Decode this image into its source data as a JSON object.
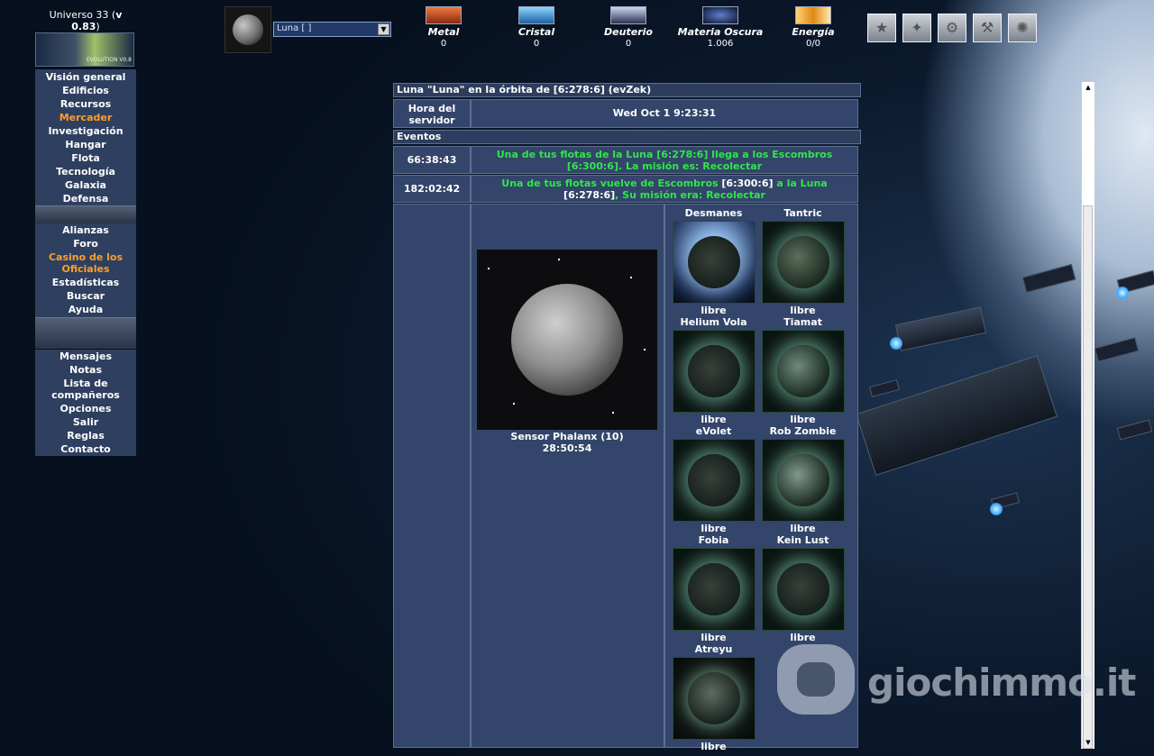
{
  "header": {
    "universe_label": "Universo 33 (",
    "version": "v 0.83",
    "universe_close": ")",
    "banner_text": "EVOLUTION V0.8",
    "planet_select_value": "Luna [ ]"
  },
  "resources": [
    {
      "name": "Metal",
      "value": "0"
    },
    {
      "name": "Cristal",
      "value": "0"
    },
    {
      "name": "Deuterio",
      "value": "0"
    },
    {
      "name": "Materia Oscura",
      "value": "1.006"
    },
    {
      "name": "Energía",
      "value": "0/0"
    }
  ],
  "menu": {
    "group1": [
      "Visión general",
      "Edificios",
      "Recursos",
      "Mercader",
      "Investigación",
      "Hangar",
      "Flota",
      "Tecnología",
      "Galaxia",
      "Defensa"
    ],
    "group2": [
      "Alianzas",
      "Foro",
      "Casino de los Oficiales",
      "Estadísticas",
      "Buscar",
      "Ayuda"
    ],
    "group3": [
      "Mensajes",
      "Notas",
      "Lista de compañeros",
      "Opciones",
      "Salir",
      "Reglas",
      "Contacto"
    ]
  },
  "overview": {
    "title": "Luna \"Luna\" en la órbita de [6:278:6] (evZek)",
    "server_time_label": "Hora del servidor",
    "server_time_value": "Wed Oct 1 9:23:31",
    "events_label": "Eventos",
    "events": [
      {
        "timer": "66:38:43",
        "text": "Una de tus flotas de la Luna [6:278:6] llega a los Escombros [6:300:6]. La misión es: Recolectar"
      },
      {
        "timer": "182:02:42",
        "text_a": "Una de tus flotas vuelve de Escombros ",
        "coords_a": "[6:300:6]",
        "text_b": " a la Luna ",
        "coords_b": "[6:278:6]",
        "text_c": ", Su misión era: Recolectar"
      }
    ],
    "phalanx_label": "Sensor Phalanx (10)",
    "phalanx_timer": "28:50:54"
  },
  "moons": [
    {
      "name": "Desmanes",
      "status": "libre"
    },
    {
      "name": "Tantric",
      "status": "libre"
    },
    {
      "name": "Helium Vola",
      "status": "libre"
    },
    {
      "name": "Tiamat",
      "status": "libre"
    },
    {
      "name": "eVolet",
      "status": "libre"
    },
    {
      "name": "Rob Zombie",
      "status": "libre"
    },
    {
      "name": "Fobia",
      "status": "libre"
    },
    {
      "name": "Kein Lust",
      "status": "libre"
    },
    {
      "name": "Atreyu",
      "status": "libre"
    }
  ],
  "watermark": {
    "text": "giochimmo.it"
  },
  "colors": {
    "menu_bg": "#2e3f5f",
    "panel_bg": "#33456a",
    "event_green": "#2fe64a",
    "accent_orange": "#ff9e2a"
  }
}
